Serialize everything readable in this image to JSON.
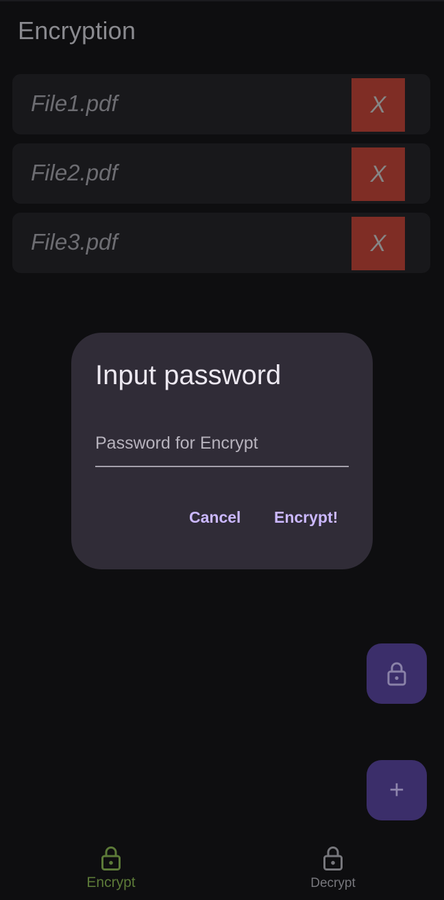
{
  "app": {
    "title": "Encryption"
  },
  "files": [
    {
      "name": "File1.pdf",
      "remove_label": "X"
    },
    {
      "name": "File2.pdf",
      "remove_label": "X"
    },
    {
      "name": "File3.pdf",
      "remove_label": "X"
    }
  ],
  "dialog": {
    "title": "Input password",
    "password_placeholder": "Password for Encrypt",
    "password_value": "",
    "cancel_label": "Cancel",
    "confirm_label": "Encrypt!"
  },
  "fabs": {
    "lock_icon": "lock-icon",
    "add_label": "+"
  },
  "bottom_nav": {
    "items": [
      {
        "label": "Encrypt",
        "icon": "lock-icon",
        "selected": true
      },
      {
        "label": "Decrypt",
        "icon": "lock-icon",
        "selected": false
      }
    ]
  },
  "colors": {
    "background": "#0e0e10",
    "card": "#18181b",
    "remove_button": "#7f2d25",
    "dialog": "#302c37",
    "accent": "#cbb8ff",
    "fab": "#3b2e6a",
    "nav_selected": "#5c7a38",
    "nav_unselected": "#77777c"
  }
}
